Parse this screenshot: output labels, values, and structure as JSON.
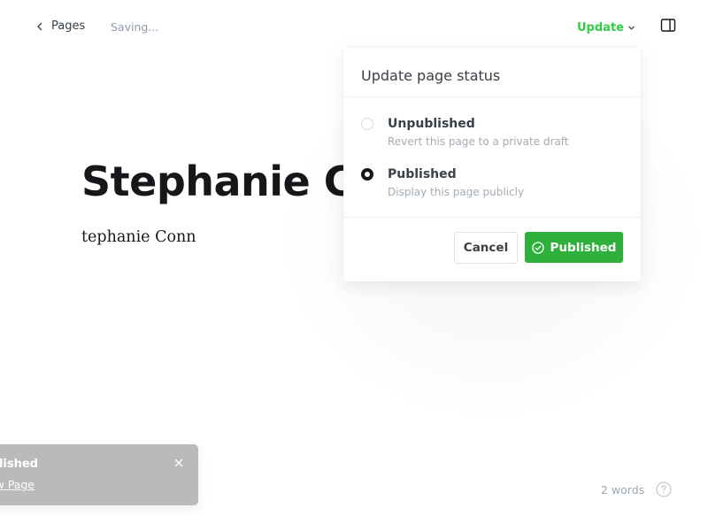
{
  "header": {
    "back_label": "Pages",
    "status": "Saving...",
    "update_label": "Update"
  },
  "editor": {
    "title": "Stephanie Conn",
    "body": "tephanie Conn"
  },
  "popover": {
    "title": "Update page status",
    "options": [
      {
        "label": "Unpublished",
        "description": "Revert this page to a private draft",
        "selected": false
      },
      {
        "label": "Published",
        "description": "Display this page publicly",
        "selected": true
      }
    ],
    "cancel_label": "Cancel",
    "publish_label": "Published"
  },
  "toast": {
    "title": "Published",
    "link": "View Page"
  },
  "footer": {
    "word_count": "2 words"
  },
  "colors": {
    "accent_green": "#30cf43",
    "publish_button": "#2faf3c",
    "toast_bg": "#b9babc"
  },
  "icons": [
    "chevron-left-icon",
    "chevron-down-icon",
    "sidebar-toggle-icon",
    "check-circle-icon",
    "close-icon",
    "help-icon"
  ]
}
